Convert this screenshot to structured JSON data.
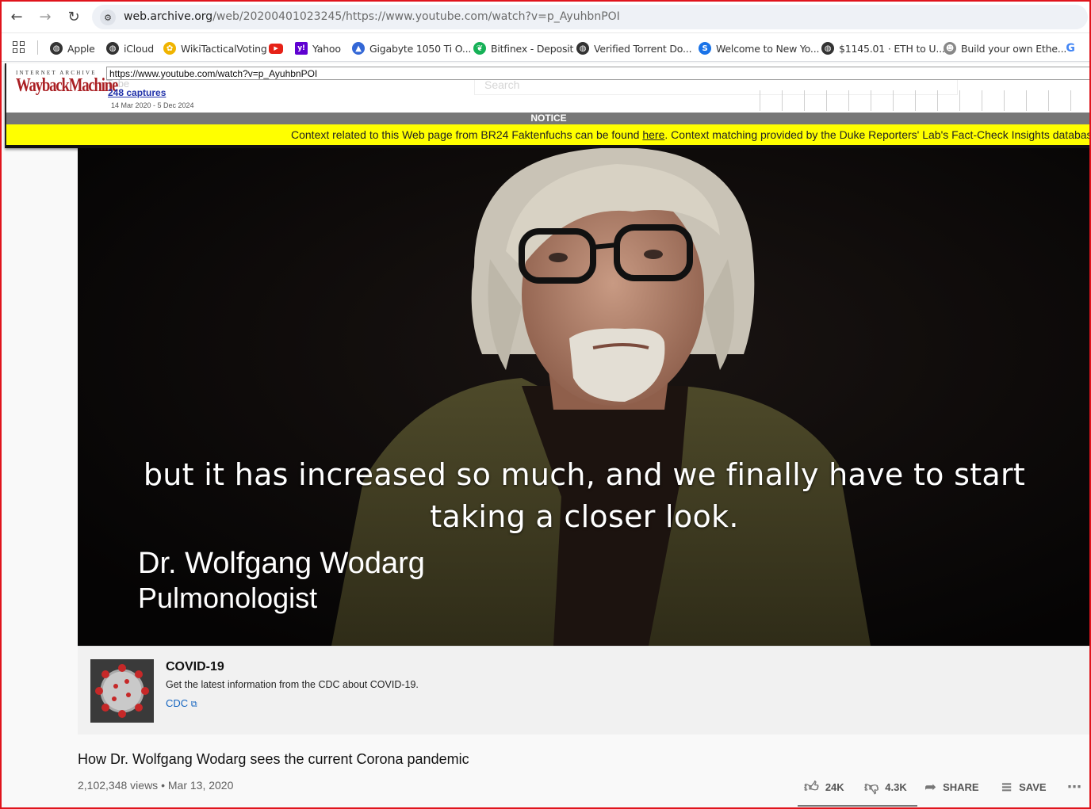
{
  "browser": {
    "url_host": "web.archive.org",
    "url_path": "/web/20200401023245/https://www.youtube.com/watch?v=p_AyuhbnPOI",
    "bookmarks": [
      {
        "label": "Apple",
        "icon": "globe-icon",
        "color": "#333333"
      },
      {
        "label": "iCloud",
        "icon": "globe-icon",
        "color": "#333333"
      },
      {
        "label": "WikiTacticalVoting",
        "icon": "flower-icon",
        "color": "#f0b400"
      },
      {
        "label": "",
        "icon": "youtube-icon",
        "color": "#e62117"
      },
      {
        "label": "Yahoo",
        "icon": "yahoo-icon",
        "color": "#5f01d1"
      },
      {
        "label": "Gigabyte 1050 Ti O...",
        "icon": "triangle-icon",
        "color": "#3367d6"
      },
      {
        "label": "Bitfinex - Deposit",
        "icon": "leaf-icon",
        "color": "#16b157"
      },
      {
        "label": "Verified Torrent Do...",
        "icon": "globe-icon",
        "color": "#333333"
      },
      {
        "label": "Welcome to New Yo...",
        "icon": "s-icon",
        "color": "#1a73e8"
      },
      {
        "label": "$1145.01 · ETH to U...",
        "icon": "globe-icon",
        "color": "#333333"
      },
      {
        "label": "Build your own Ethe...",
        "icon": "robot-icon",
        "color": "#888888"
      },
      {
        "label": "G",
        "icon": "google-icon",
        "color": "#4285f4"
      }
    ]
  },
  "wayback": {
    "logo_top": "INTERNET ARCHIVE",
    "logo_main": "WaybackMachine",
    "url_value": "https://www.youtube.com/watch?v=p_AyuhbnPOI",
    "captures": "248 captures",
    "range": "14 Mar 2020 - 5 Dec 2024",
    "ghost_search": "Search",
    "notice": "NOTICE",
    "context_pre": "Context related to this Web page from BR24 Faktenfuchs can be found ",
    "context_link": "here",
    "context_post": ". Context matching provided by the Duke Reporters' Lab's Fact-Check Insights databas"
  },
  "video": {
    "subtitle_line1": "but it has increased so much, and we finally have to start",
    "subtitle_line2": "taking a closer look.",
    "name": "Dr. Wolfgang Wodarg",
    "role": "Pulmonologist"
  },
  "covid_panel": {
    "title": "COVID-19",
    "description": "Get the latest information from the CDC about COVID-19.",
    "link": "CDC"
  },
  "details": {
    "title": "How Dr. Wolfgang Wodarg sees the current Corona pandemic",
    "views": "2,102,348 views",
    "date": "Mar 13, 2020",
    "likes": "24K",
    "dislikes": "4.3K",
    "share": "SHARE",
    "save": "SAVE"
  }
}
